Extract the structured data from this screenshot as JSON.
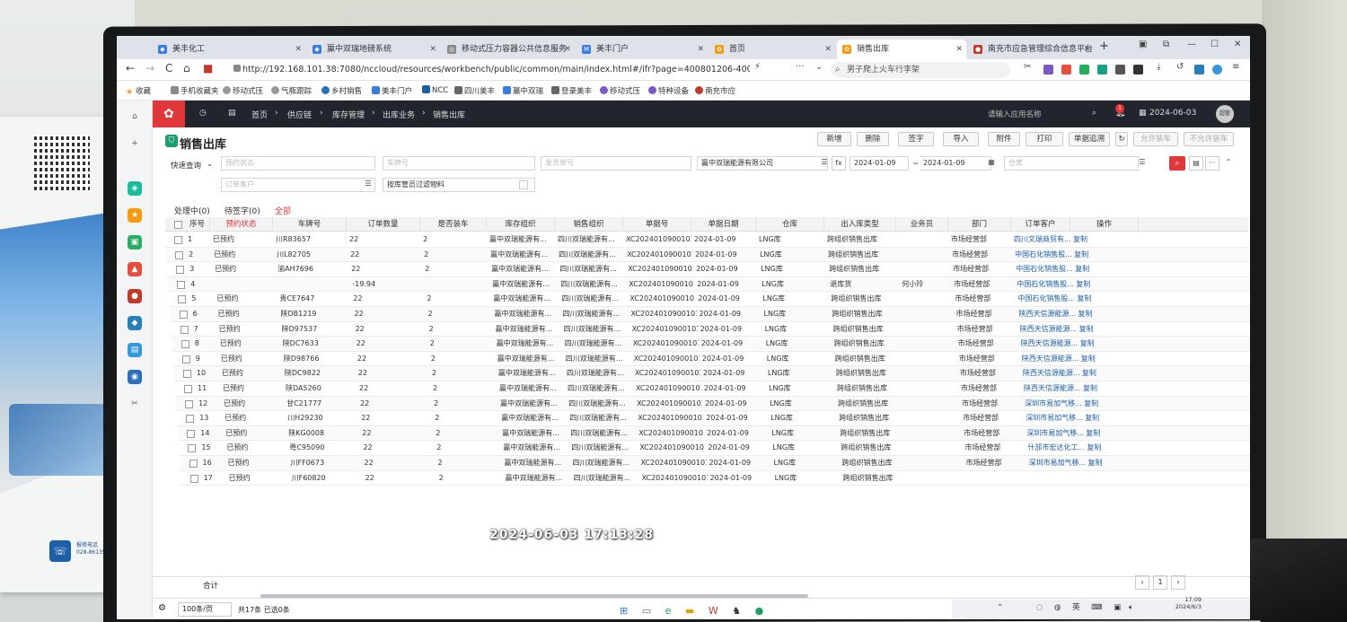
{
  "browser": {
    "tabs": [
      {
        "label": "美丰化工",
        "left": 0
      },
      {
        "label": "鸁中双瑞地磅系统"
      },
      {
        "label": "移动式压力容器公共信息服务"
      },
      {
        "label": "美丰门户"
      },
      {
        "label": "首页"
      },
      {
        "label": "销售出库"
      },
      {
        "label": "南充市应急管理综合信息平台"
      }
    ],
    "url": "http://192.168.101.38:7080/nccloud/resources/workbench/public/common/main/index.html#/ifr?page=400801206-400801206",
    "search_text": "男子爬上火车行李架",
    "bookmarks": [
      "收藏",
      "手机收藏夹",
      "移动式压",
      "气瓶跟踪",
      "乡村销售",
      "美丰门户",
      "NCC",
      "四川美丰",
      "鸁中双瑞",
      "登录美丰",
      "移动式压",
      "特种设备",
      "南充市应"
    ]
  },
  "app": {
    "breadcrumb": [
      "首页",
      "供应链",
      "库存管理",
      "出库业务",
      "销售出库"
    ],
    "search_placeholder": "请输入应用名称",
    "notification_count": "1",
    "date": "2024-06-03",
    "avatar": "超管"
  },
  "page": {
    "title": "销售出库",
    "toolbar": [
      "新增",
      "删除",
      "签字",
      "导入",
      "附件",
      "打印",
      "单据追溯",
      "允许装车",
      "不允许装车"
    ]
  },
  "filters": {
    "quick_query": "快速查询",
    "booking_status": "预约状态",
    "plate": "车牌号",
    "delivery_no": "发货单号",
    "org": "鸁中双瑞能源有限公司",
    "date_from": "2024-01-09",
    "date_to": "2024-01-09",
    "warehouse": "仓库",
    "customer": "订单客户",
    "checkbox_label": "按库管员过滤物料"
  },
  "subtabs": [
    "处理中(0)",
    "待签字(0)",
    "全部"
  ],
  "grid": {
    "headers": [
      "序号",
      "预约状态",
      "车牌号",
      "订单数量",
      "是否装车",
      "库存组织",
      "销售组织",
      "单据号",
      "单据日期",
      "仓库",
      "出入库类型",
      "业务员",
      "部门",
      "订单客户",
      "操作"
    ],
    "rows": [
      [
        "1",
        "已预约",
        "川R83657",
        "22",
        "2",
        "鸁中双瑞能源有...",
        "四川双瑞能源有...",
        "XC2024010900101...",
        "2024-01-09",
        "LNG库",
        "跨组织销售出库",
        "",
        "市场经营部",
        "四川文瑞商贸有...",
        "复制"
      ],
      [
        "2",
        "已预约",
        "川L82705",
        "22",
        "2",
        "鸁中双瑞能源有...",
        "四川双瑞能源有...",
        "XC2024010900101...",
        "2024-01-09",
        "LNG库",
        "跨组织销售出库",
        "",
        "市场经营部",
        "中国石化销售股...",
        "复制"
      ],
      [
        "3",
        "已预约",
        "渝AH7696",
        "22",
        "2",
        "鸁中双瑞能源有...",
        "四川双瑞能源有...",
        "XC2024010900101...",
        "2024-01-09",
        "LNG库",
        "跨组织销售出库",
        "",
        "市场经营部",
        "中国石化销售股...",
        "复制"
      ],
      [
        "4",
        "",
        "",
        "-19.94",
        "",
        "鸁中双瑞能源有...",
        "四川双瑞能源有...",
        "XC2024010900101...",
        "2024-01-09",
        "LNG库",
        "退库货",
        "何小玲",
        "市场经营部",
        "中国石化销售股...",
        "复制"
      ],
      [
        "5",
        "已预约",
        "贵CE7647",
        "22",
        "2",
        "鸁中双瑞能源有...",
        "四川双瑞能源有...",
        "XC2024010900101...",
        "2024-01-09",
        "LNG库",
        "跨组织销售出库",
        "",
        "市场经营部",
        "中国石化销售股...",
        "复制"
      ],
      [
        "6",
        "已预约",
        "陕DB1219",
        "22",
        "2",
        "鸁中双瑞能源有...",
        "四川双瑞能源有...",
        "XC2024010900101...",
        "2024-01-09",
        "LNG库",
        "跨组织销售出库",
        "",
        "市场经营部",
        "陕西天信源能源...",
        "复制"
      ],
      [
        "7",
        "已预约",
        "陕D97537",
        "22",
        "2",
        "鸁中双瑞能源有...",
        "四川双瑞能源有...",
        "XC2024010900101...",
        "2024-01-09",
        "LNG库",
        "跨组织销售出库",
        "",
        "市场经营部",
        "陕西天信源能源...",
        "复制"
      ],
      [
        "8",
        "已预约",
        "陕DC7633",
        "22",
        "2",
        "鸁中双瑞能源有...",
        "四川双瑞能源有...",
        "XC2024010900101...",
        "2024-01-09",
        "LNG库",
        "跨组织销售出库",
        "",
        "市场经营部",
        "陕西天信源能源...",
        "复制"
      ],
      [
        "9",
        "已预约",
        "陕D98766",
        "22",
        "2",
        "鸁中双瑞能源有...",
        "四川双瑞能源有...",
        "XC2024010900101...",
        "2024-01-09",
        "LNG库",
        "跨组织销售出库",
        "",
        "市场经营部",
        "陕西天信源能源...",
        "复制"
      ],
      [
        "10",
        "已预约",
        "陕DC9822",
        "22",
        "2",
        "鸁中双瑞能源有...",
        "四川双瑞能源有...",
        "XC2024010900101...",
        "2024-01-09",
        "LNG库",
        "跨组织销售出库",
        "",
        "市场经营部",
        "陕西天信源能源...",
        "复制"
      ],
      [
        "11",
        "已预约",
        "陕DA5260",
        "22",
        "2",
        "鸁中双瑞能源有...",
        "四川双瑞能源有...",
        "XC2024010900101...",
        "2024-01-09",
        "LNG库",
        "跨组织销售出库",
        "",
        "市场经营部",
        "陕西天信源能源...",
        "复制"
      ],
      [
        "12",
        "已预约",
        "甘C21777",
        "22",
        "2",
        "鸁中双瑞能源有...",
        "四川双瑞能源有...",
        "XC2024010900101...",
        "2024-01-09",
        "LNG库",
        "跨组织销售出库",
        "",
        "市场经营部",
        "深圳市易加气移...",
        "复制"
      ],
      [
        "13",
        "已预约",
        "川H29230",
        "22",
        "2",
        "鸁中双瑞能源有...",
        "四川双瑞能源有...",
        "XC2024010900101...",
        "2024-01-09",
        "LNG库",
        "跨组织销售出库",
        "",
        "市场经营部",
        "深圳市易加气移...",
        "复制"
      ],
      [
        "14",
        "已预约",
        "陕KG0008",
        "22",
        "2",
        "鸁中双瑞能源有...",
        "四川双瑞能源有...",
        "XC2024010900101...",
        "2024-01-09",
        "LNG库",
        "跨组织销售出库",
        "",
        "市场经营部",
        "深圳市易加气移...",
        "复制"
      ],
      [
        "15",
        "已预约",
        "粤C95090",
        "22",
        "2",
        "鸁中双瑞能源有...",
        "四川双瑞能源有...",
        "XC2024010900101...",
        "2024-01-09",
        "LNG库",
        "跨组织销售出库",
        "",
        "市场经营部",
        "什邡市宏达化工...",
        "复制"
      ],
      [
        "16",
        "已预约",
        "川FF0673",
        "22",
        "2",
        "鸁中双瑞能源有...",
        "四川双瑞能源有...",
        "XC2024010900101...",
        "2024-01-09",
        "LNG库",
        "跨组织销售出库",
        "",
        "市场经营部",
        "深圳市易加气移...",
        "复制"
      ],
      [
        "17",
        "已预约",
        "川F60820",
        "22",
        "2",
        "鸁中双瑞能源有...",
        "四川双瑞能源有...",
        "XC2024010900101...",
        "2024-01-09",
        "LNG库",
        "跨组织销售出库",
        "",
        "",
        "",
        ""
      ]
    ]
  },
  "footer": {
    "sum_label": "合计",
    "page_size": "100条/页",
    "total": "共17条 已选0条",
    "page": "1"
  },
  "timestamp": "2024-06-03 17:13:28",
  "system": {
    "time": "17:09",
    "date": "2024/6/3",
    "ime": "英"
  },
  "flyer": {
    "hotline_label": "报修电话",
    "hotline_number": "028-86135816"
  }
}
